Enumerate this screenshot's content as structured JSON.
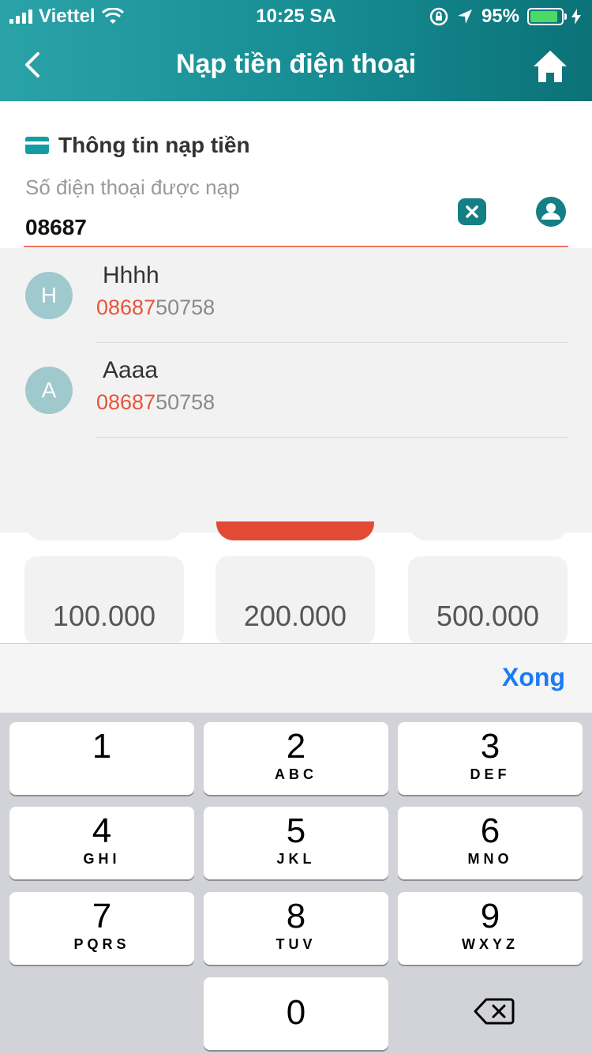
{
  "status_bar": {
    "carrier": "Viettel",
    "time": "10:25 SA",
    "battery": "95%"
  },
  "nav": {
    "title": "Nạp tiền điện thoại"
  },
  "form": {
    "section_title": "Thông tin nạp tiền",
    "phone_label": "Số điện thoại được nạp",
    "phone_value": "08687"
  },
  "suggestions": [
    {
      "initial": "H",
      "name": "Hhhh",
      "match": "08687",
      "rest": "50758"
    },
    {
      "initial": "A",
      "name": "Aaaa",
      "match": "08687",
      "rest": "50758"
    }
  ],
  "amounts": [
    "100.000",
    "200.000",
    "500.000"
  ],
  "keyboard": {
    "done_label": "Xong",
    "keys": [
      {
        "num": "1",
        "letters": ""
      },
      {
        "num": "2",
        "letters": "ABC"
      },
      {
        "num": "3",
        "letters": "DEF"
      },
      {
        "num": "4",
        "letters": "GHI"
      },
      {
        "num": "5",
        "letters": "JKL"
      },
      {
        "num": "6",
        "letters": "MNO"
      },
      {
        "num": "7",
        "letters": "PQRS"
      },
      {
        "num": "8",
        "letters": "TUV"
      },
      {
        "num": "9",
        "letters": "WXYZ"
      },
      {
        "num": "0",
        "letters": ""
      }
    ]
  },
  "colors": {
    "header": "#169ca3",
    "accent": "#e8543a",
    "done": "#1a7cf3"
  }
}
